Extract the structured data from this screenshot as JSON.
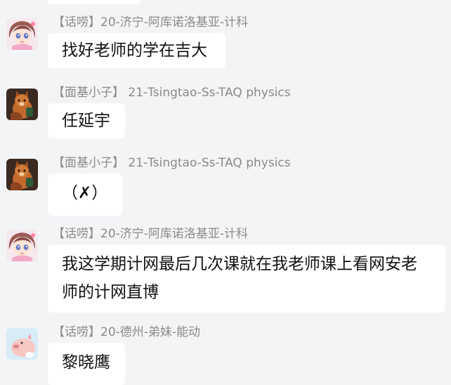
{
  "messages": [
    {
      "sender": "【话唠】20-济宁-阿库诺洛基亚-计科",
      "text": "找好老师的学在吉大",
      "avatar": "anime-girl-avatar"
    },
    {
      "sender": "【面基小子】 21-Tsingtao-Ss-TAQ physics",
      "text": "任延宇",
      "avatar": "fox-avatar"
    },
    {
      "sender": "【面基小子】 21-Tsingtao-Ss-TAQ physics",
      "text": "（✗）",
      "avatar": "fox-avatar"
    },
    {
      "sender": "【话唠】20-济宁-阿库诺洛基亚-计科",
      "text": "我这学期计网最后几次课就在我老师课上看网安老师的计网直博",
      "avatar": "anime-girl-avatar"
    },
    {
      "sender": "【话唠】20-德州-弟妹-能动",
      "text": "黎晓鹰",
      "avatar": "cartoon-pig-avatar"
    }
  ]
}
